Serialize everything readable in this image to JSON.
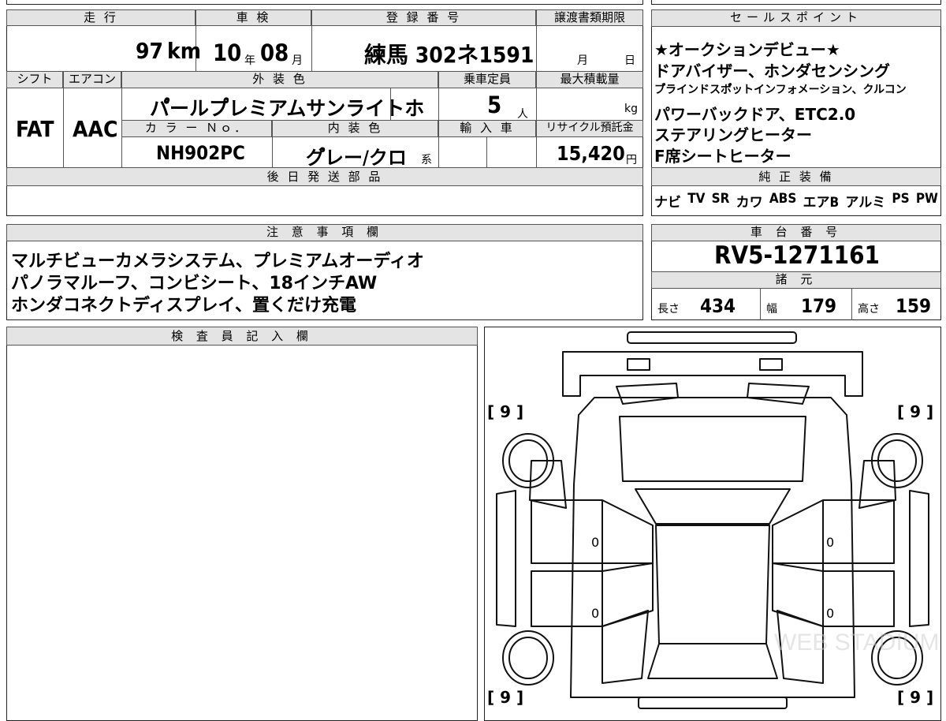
{
  "top": {
    "headers": {
      "mileage": "走 行",
      "shaken": "車 検",
      "registration": "登 録 番 号",
      "transfer_deadline": "譲渡書類期限",
      "shift": "シフト",
      "aircon": "エアコン",
      "exterior_color": "外 装 色",
      "capacity": "乗車定員",
      "max_load": "最大積載量",
      "color_no": "カ ラ ー Ｎｏ．",
      "interior_color": "内 装 色",
      "import": "輸 入 車",
      "recycle_fee": "リサイクル預託金",
      "later_parts": "後 日 発 送 部 品"
    },
    "mileage_value": "97",
    "mileage_unit": "km",
    "shaken_year": "10",
    "shaken_year_unit": "年",
    "shaken_month": "08",
    "shaken_month_unit": "月",
    "registration_value": "練馬 302ネ1591",
    "deadline_month_unit": "月",
    "deadline_day_unit": "日",
    "shift_value": "FAT",
    "aircon_value": "AAC",
    "exterior_color_value": "パ゚ールプ゚レミアムサンライトホ",
    "capacity_value": "5",
    "capacity_unit": "人",
    "load_unit": "kg",
    "color_no_value": "NH902PC",
    "interior_color_value": "グ゚レー/クロ",
    "interior_suffix": "系",
    "recycle_value": "15,420",
    "recycle_unit": "円"
  },
  "sales": {
    "header": "セールスポイント",
    "lines": [
      "★オークションデビュー★",
      "ドアバイザー、ホンダセンシング",
      "ブ゚ラインドスポ゚ットインフォメーション、クルコン",
      "パワーバックドア、ETC2.0",
      "ステアリングヒーター",
      "F席シートヒーター"
    ],
    "equipment_header": "純 正 装 備",
    "equipment": [
      "ナビ",
      "TV",
      "SR",
      "カワ",
      "ABS",
      "エアB",
      "アルミ",
      "PS",
      "PW"
    ]
  },
  "notes": {
    "header": "注 意 事 項 欄",
    "lines": [
      "マルチビューカメラシステム、プレミアムオーディオ",
      "パノラマルーフ、コンビシート、18インチAW",
      "ホンダコネクトディスプレイ、置くだけ充電"
    ]
  },
  "chassis": {
    "header": "車 台 番 号",
    "value": "RV5-1271161",
    "spec_header": "諸 元",
    "length_label": "長さ",
    "length_value": "434",
    "width_label": "幅",
    "width_value": "179",
    "height_label": "高さ",
    "height_value": "159"
  },
  "inspector": {
    "header": "検 査 員 記 入 欄"
  },
  "diagram": {
    "tire_tl": "[ 9 ]",
    "tire_tr": "[ 9 ]",
    "tire_bl": "[ 9 ]",
    "tire_br": "[ 9 ]",
    "door_fl": "0",
    "door_rl": "0",
    "door_fr": "0",
    "door_rr": "0",
    "watermark": "WEB STADIUM"
  }
}
